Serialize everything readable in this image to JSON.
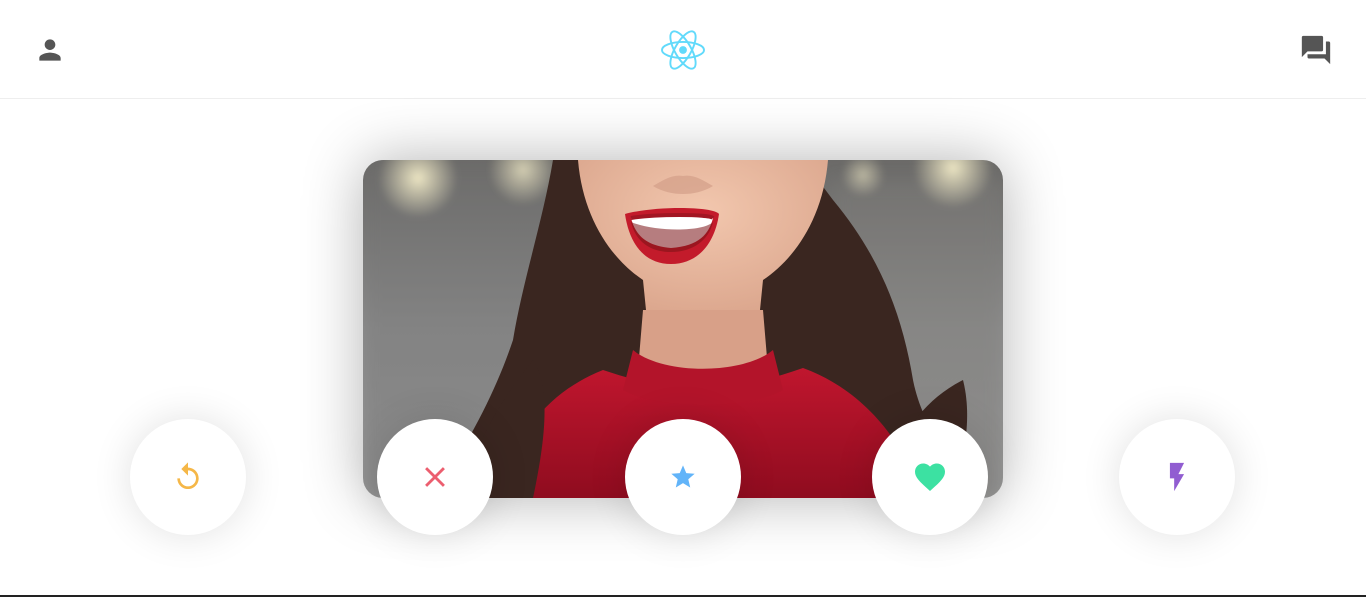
{
  "header": {
    "profile_icon": "person-icon",
    "logo_icon": "react-atom-logo",
    "messages_icon": "forum-icon"
  },
  "card": {
    "photo": "smiling-woman-red-lipstick-red-sweater"
  },
  "actions": [
    {
      "name": "undo",
      "icon": "replay-icon",
      "color": "#F5B748"
    },
    {
      "name": "nope",
      "icon": "close-icon",
      "color": "#EC5E6F"
    },
    {
      "name": "super-like",
      "icon": "star-icon",
      "color": "#62B4F9"
    },
    {
      "name": "like",
      "icon": "heart-icon",
      "color": "#3CE1A2"
    },
    {
      "name": "boost",
      "icon": "flash-icon",
      "color": "#915DD1"
    }
  ],
  "colors": {
    "header_icon": "#555555",
    "logo": "#61DAFB",
    "background": "#FFFFFF"
  }
}
